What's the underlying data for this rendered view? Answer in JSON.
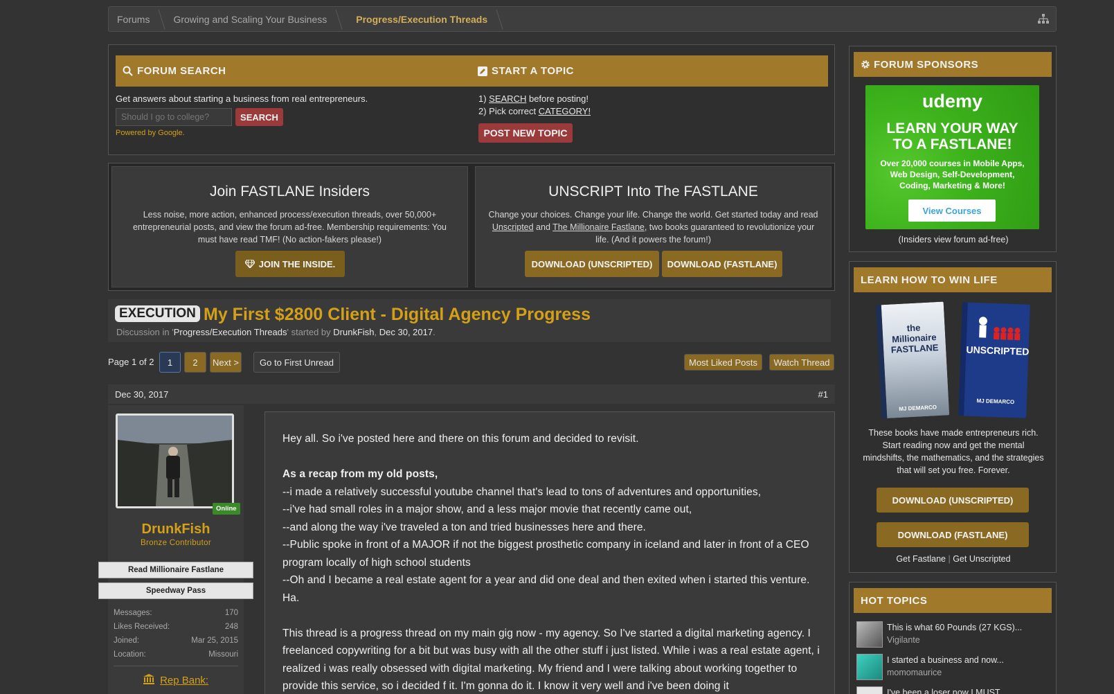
{
  "breadcrumb": {
    "items": [
      "Forums",
      "Growing and Scaling Your Business",
      "Progress/Execution Threads"
    ]
  },
  "forum_search": {
    "heading": "FORUM SEARCH",
    "description": "Get answers about starting a business from real entrepreneurs.",
    "placeholder": "Should I go to college?",
    "button": "SEARCH",
    "powered": "Powered by Google."
  },
  "start_topic": {
    "heading": "START A TOPIC",
    "step1_prefix": "1) ",
    "step1_link": "SEARCH",
    "step1_suffix": " before posting!",
    "step2_prefix": "2) Pick correct ",
    "step2_link": "CATEGORY!",
    "button": "POST NEW TOPIC"
  },
  "insiders": {
    "title": "Join FASTLANE Insiders",
    "text": "Less noise, more action, enhanced process/execution threads, over 50,000+ entrepreneurial posts, and view the forum ad-free. Membership requirements: You must have read TMF! (No action-fakers please!)",
    "button": "JOIN THE INSIDE."
  },
  "unscript": {
    "title": "UNSCRIPT Into The FASTLANE",
    "text_before": "Change your choices. Change your life. Change the world. Get started today and read ",
    "link1": "Unscripted",
    "text_mid": " and ",
    "link2": "The Millionaire Fastlane",
    "text_after": ", two books guaranteed to revolutionize your life. (And it powers the forum!)",
    "button1": "DOWNLOAD (UNSCRIPTED)",
    "button2": "DOWNLOAD (FASTLANE)"
  },
  "thread": {
    "prefix": "EXECUTION",
    "title": "My First $2800 Client - Digital Agency Progress",
    "meta_prefix": "Discussion in '",
    "forum": "Progress/Execution Threads",
    "meta_started": "' started by ",
    "author": "DrunkFish",
    "comma": ", ",
    "date": "Dec 30, 2017",
    "dot": "."
  },
  "pagenav": {
    "label": "Page 1 of 2",
    "page1": "1",
    "page2": "2",
    "next": "Next >",
    "first_unread": "Go to First Unread",
    "most_liked": "Most Liked Posts",
    "watch": "Watch Thread"
  },
  "message": {
    "date": "Dec 30, 2017",
    "number": "#1"
  },
  "user": {
    "online": "Online",
    "name": "DrunkFish",
    "title": "Bronze Contributor",
    "banner1": "Read Millionaire Fastlane",
    "banner2": "Speedway Pass",
    "stats": [
      {
        "label": "Messages:",
        "value": "170"
      },
      {
        "label": "Likes Received:",
        "value": "248"
      },
      {
        "label": "Joined:",
        "value": "Mar 25, 2015"
      },
      {
        "label": "Location:",
        "value": "Missouri"
      }
    ],
    "rep_bank": "Rep Bank:"
  },
  "post": {
    "line1": "Hey all. So i've posted here and there on this forum and decided to revisit.",
    "recap_heading": "As a recap from my old posts,",
    "bullets": [
      "--i made a relatively successful youtube channel that's lead to tons of adventures and opportunities,",
      "--i've had small roles in a major show, and a less major movie that recently came out,",
      "--and along the way i've traveled a ton and tried businesses here and there.",
      "--Public spoke in front of a MAJOR if not the biggest prosthetic company in iceland and later in front of a CEO program locally of high school students",
      "--Oh and I became a real estate agent for a year and did one deal and then exited when i started this venture. Ha."
    ],
    "para2": "This thread is a progress thread on my main gig now - my agency. So I've started a digital marketing agency. I freelanced copywriting for a bit but was busy with all the other stuff i just listed. While i was a real estate agent, i realized i was really obsessed with digital marketing. My friend and I were talking about working together to provide this service, so i decided f it. I'm gonna do it. I know it very well and i've been doing it"
  },
  "sponsors": {
    "heading": "FORUM SPONSORS",
    "ad_brand": "udemy",
    "ad_headline1": "LEARN YOUR WAY",
    "ad_headline2": "TO A FASTLANE!",
    "ad_sub1": "Over 20,000 courses in Mobile Apps,",
    "ad_sub2": "Web Design, Self-Development,",
    "ad_sub3": "Coding, Marketing & More!",
    "ad_button": "View Courses",
    "caption": "(Insiders view forum ad-free)"
  },
  "learn": {
    "heading": "LEARN HOW TO WIN LIFE",
    "book1_title": "the Millionaire FASTLANE",
    "book1_author": "MJ DEMARCO",
    "book2_title": "UNSCRIPTED",
    "book2_author": "MJ DEMARCO",
    "text": "These books have made entrepreneurs rich. Start reading now and get the mental mindshifts, the mathematics, and the strategies that will set you free. Forever.",
    "button1": "DOWNLOAD (UNSCRIPTED)",
    "button2": "DOWNLOAD (FASTLANE)",
    "link1": "Get Fastlane",
    "sep": "|",
    "link2": "Get Unscripted"
  },
  "hot_topics": {
    "heading": "HOT TOPICS",
    "items": [
      {
        "title": "This is what 60 Pounds (27 KGS)...",
        "user": "Vigilante"
      },
      {
        "title": "I started a business and now...",
        "user": "momomaurice"
      },
      {
        "title": "I've been a loser now I MUST",
        "user": ""
      }
    ]
  },
  "colors": {
    "gold_bar": "#a07a2a",
    "gold_text": "#d4a017",
    "red_button": "#9b3a3a",
    "background": "#333333"
  }
}
